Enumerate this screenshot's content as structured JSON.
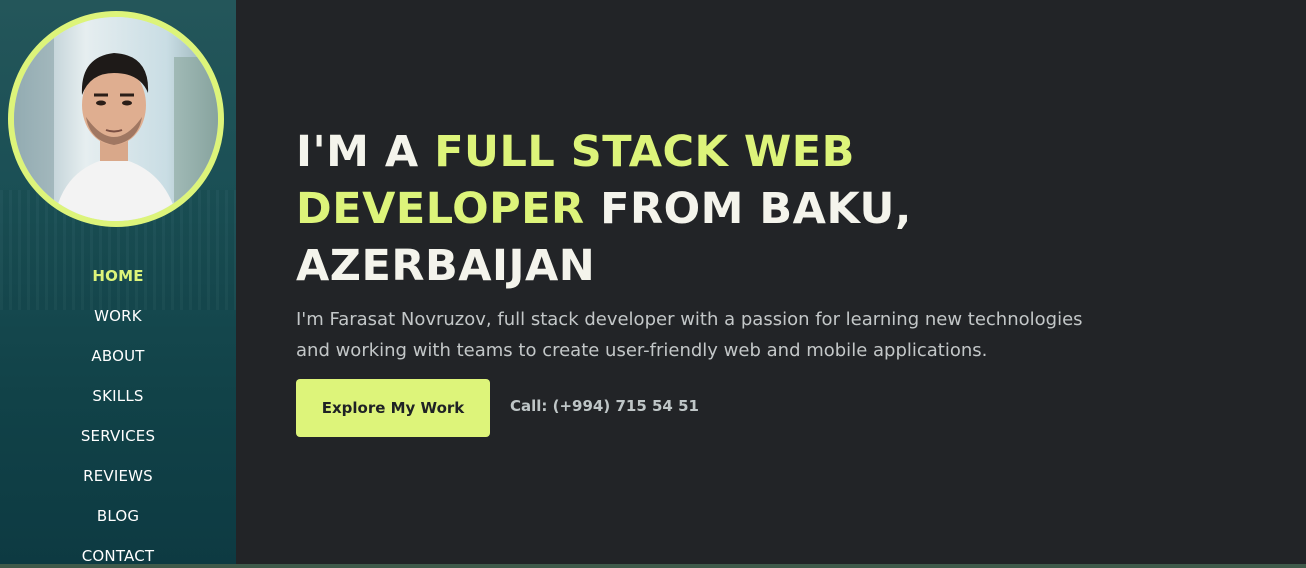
{
  "sidebar": {
    "nav": [
      {
        "label": "HOME",
        "active": true
      },
      {
        "label": "WORK",
        "active": false
      },
      {
        "label": "ABOUT",
        "active": false
      },
      {
        "label": "SKILLS",
        "active": false
      },
      {
        "label": "SERVICES",
        "active": false
      },
      {
        "label": "REVIEWS",
        "active": false
      },
      {
        "label": "BLOG",
        "active": false
      },
      {
        "label": "CONTACT",
        "active": false
      }
    ]
  },
  "hero": {
    "headline_part1": "I'M A ",
    "headline_highlight1": "FULL STACK WEB DEVELOPER",
    "headline_part2": " FROM BAKU, AZERBAIJAN",
    "intro": "I'm Farasat Novruzov, full stack developer with a passion for learning new technologies and working with teams to create user-friendly web and mobile applications.",
    "cta_label": "Explore My Work",
    "phone_text": "Call: (+994) 715 54 51"
  },
  "colors": {
    "accent": "#ddf47a",
    "background": "#222427",
    "sidebar": "#114248",
    "text": "#f4f4ec"
  }
}
